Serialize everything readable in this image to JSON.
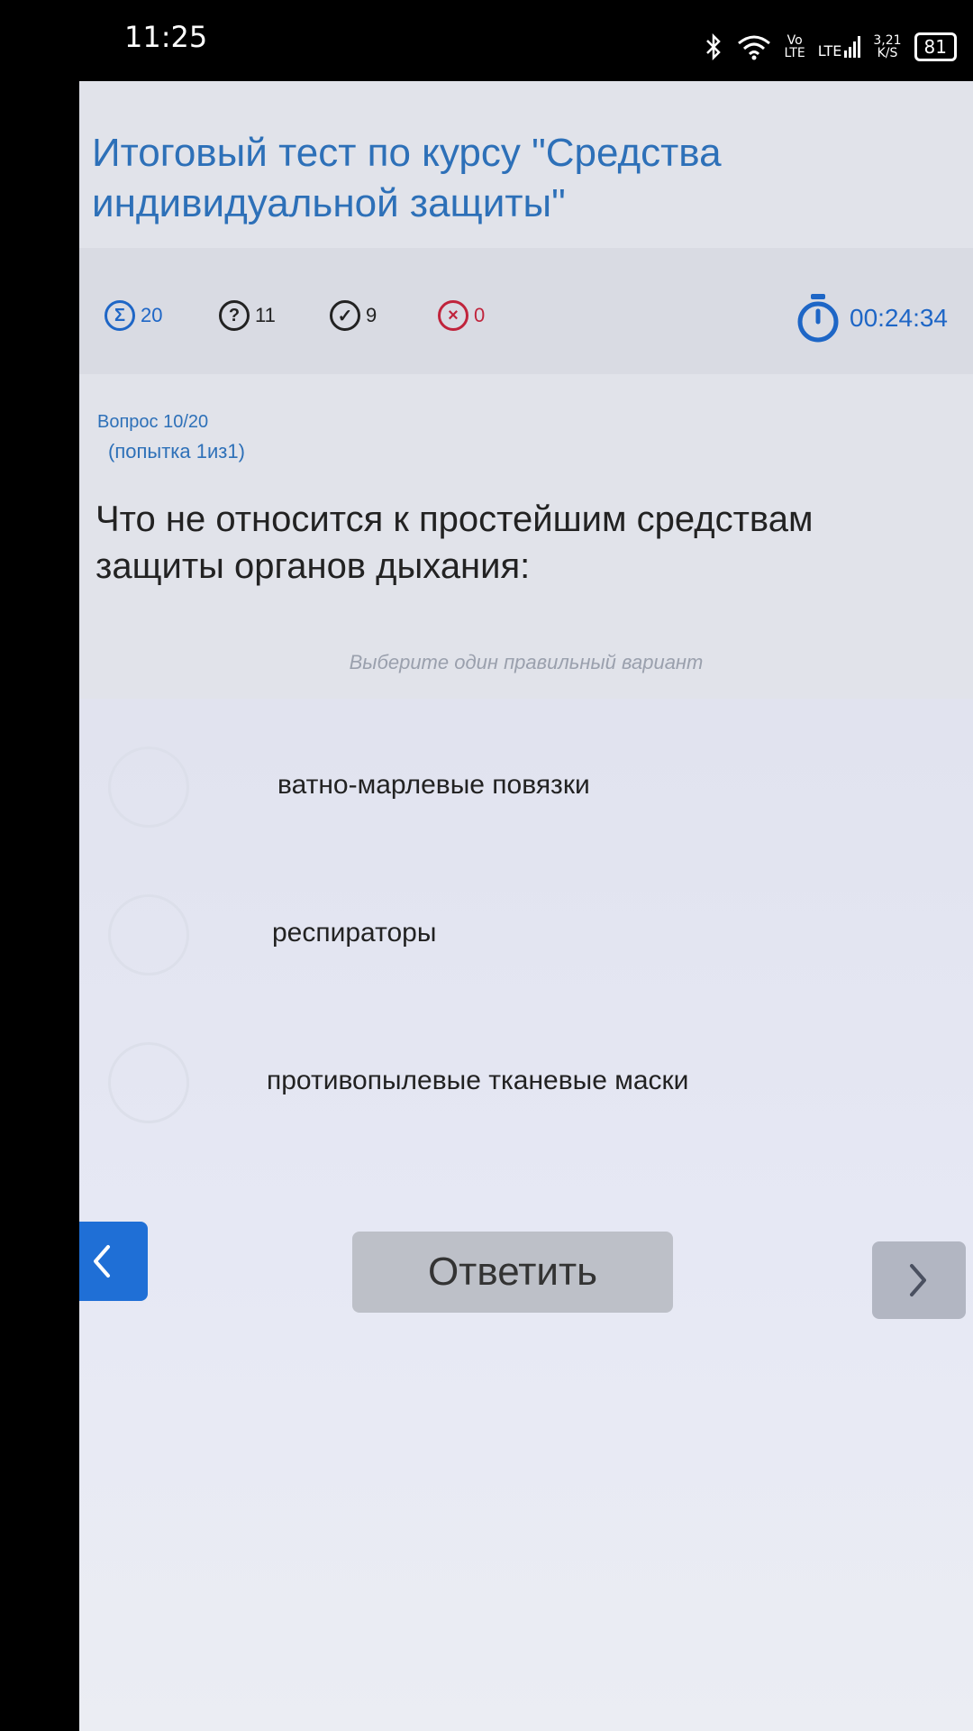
{
  "statusbar": {
    "time": "11:25",
    "volte_top": "Vo",
    "volte_bottom": "LTE",
    "lte": "LTE",
    "speed_top": "3,21",
    "speed_bottom": "K/S",
    "battery": "81"
  },
  "header": {
    "title": "Итоговый тест по курсу \"Средства индивидуальной защиты\""
  },
  "stats": {
    "total": "20",
    "unanswered": "11",
    "correct": "9",
    "wrong": "0",
    "timer": "00:24:34"
  },
  "question": {
    "number": "Вопрос 10/20",
    "attempt": "(попытка 1из1)",
    "text": "Что не относится к простейшим средствам защиты органов дыхания:",
    "hint": "Выберите один правильный вариант"
  },
  "options": [
    {
      "label": "ватно-марлевые повязки"
    },
    {
      "label": "респираторы"
    },
    {
      "label": "противопылевые тканевые маски"
    }
  ],
  "nav": {
    "prev_icon": "chevron-left-icon",
    "answer_label": "Ответить",
    "next_icon": "chevron-right-icon"
  },
  "colors": {
    "accent": "#1f6fd6",
    "title": "#2d70b8",
    "wrong": "#c0243c"
  }
}
